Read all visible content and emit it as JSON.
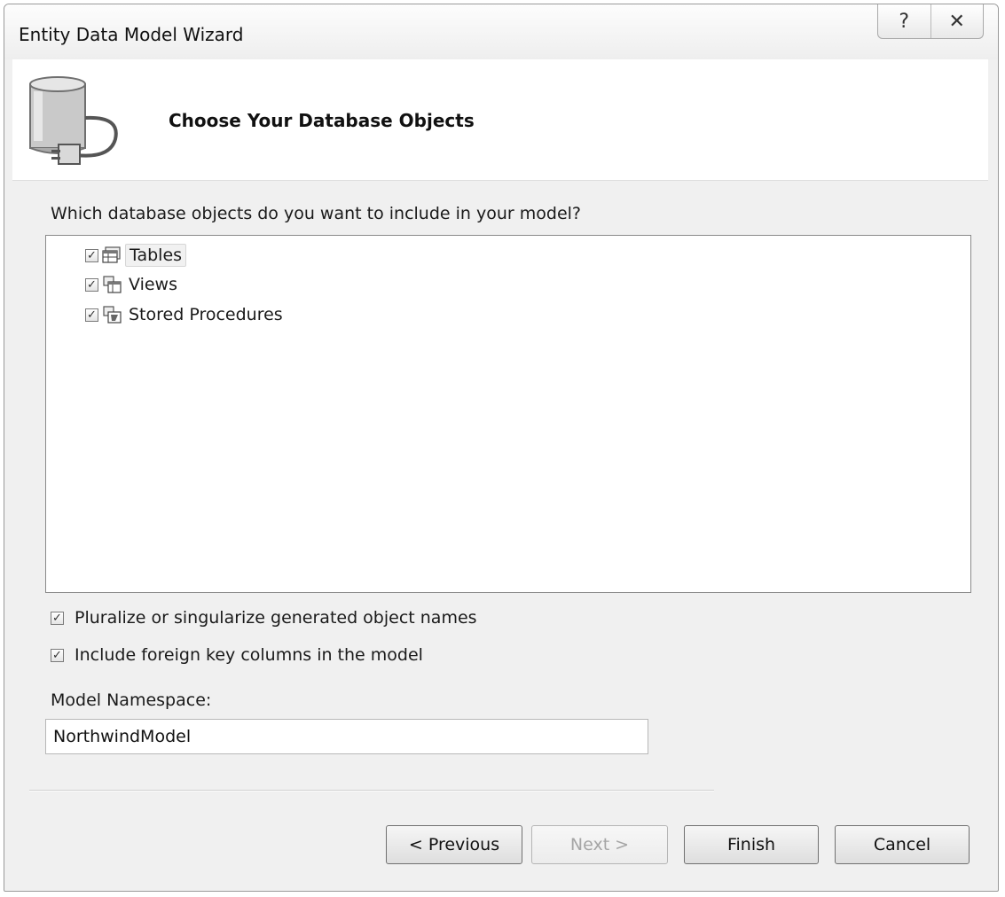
{
  "window": {
    "title": "Entity Data Model Wizard"
  },
  "title_buttons": {
    "help": "?",
    "close": "✕"
  },
  "header": {
    "title": "Choose Your Database Objects"
  },
  "tree": {
    "prompt": "Which database objects do you want to include in your model?",
    "items": [
      {
        "label": "Tables",
        "checked": true,
        "icon": "table-icon"
      },
      {
        "label": "Views",
        "checked": true,
        "icon": "view-icon"
      },
      {
        "label": "Stored Procedures",
        "checked": true,
        "icon": "stored-procedure-icon"
      }
    ]
  },
  "options": {
    "pluralize_label": "Pluralize or singularize generated object names",
    "pluralize_checked": true,
    "foreign_keys_label": "Include foreign key columns in the model",
    "foreign_keys_checked": true
  },
  "namespace": {
    "label": "Model Namespace:",
    "value": "NorthwindModel"
  },
  "buttons": {
    "previous": "< Previous",
    "next": "Next >",
    "finish": "Finish",
    "cancel": "Cancel"
  },
  "check_mark": "✓"
}
